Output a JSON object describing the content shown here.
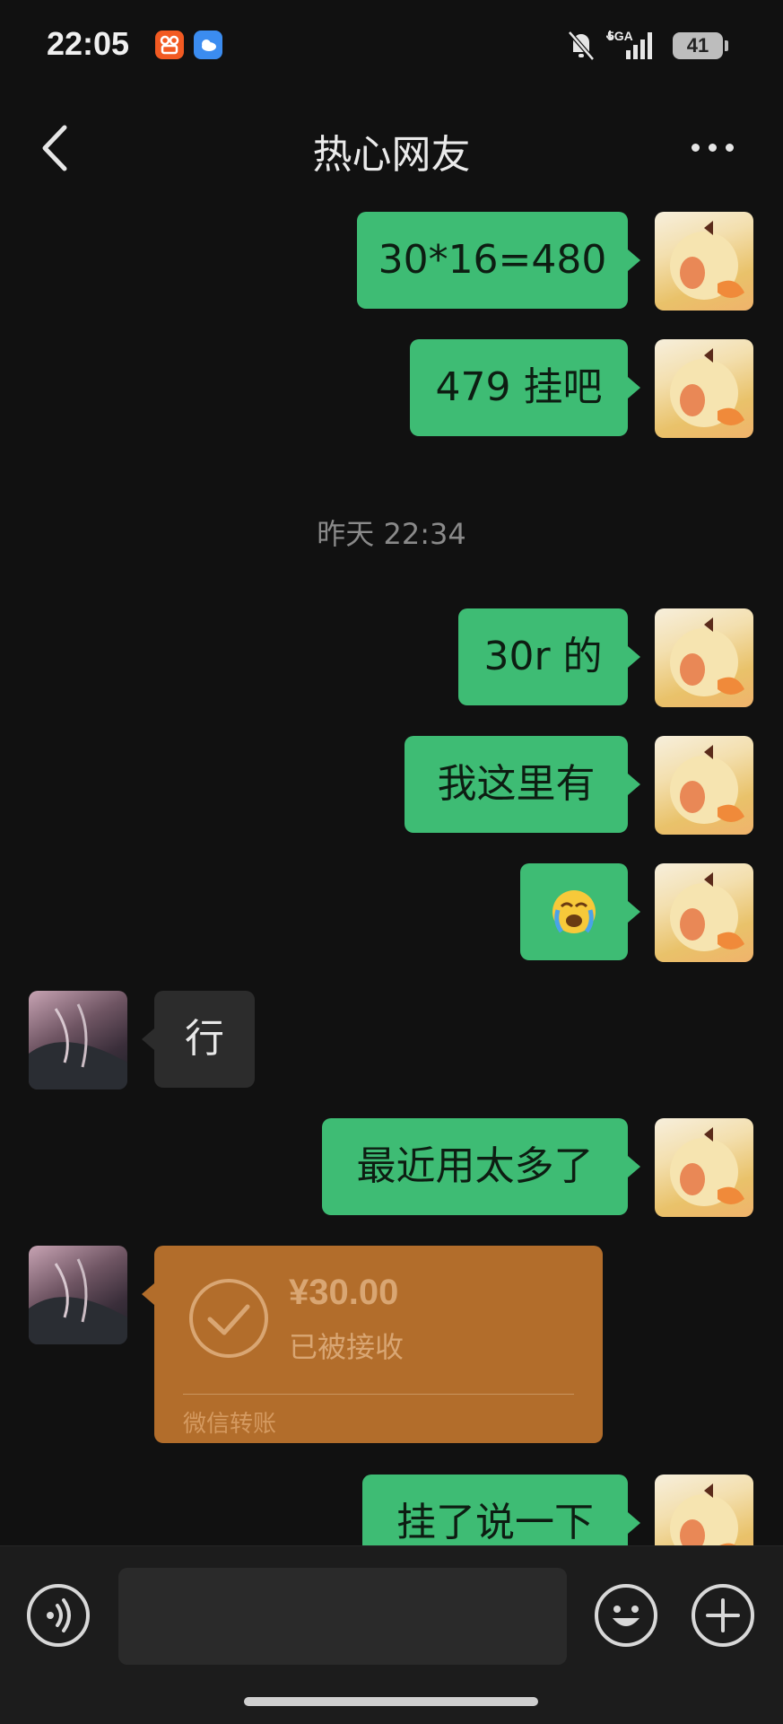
{
  "status_bar": {
    "time": "22:05",
    "network": "5GA",
    "battery": "41",
    "icons": [
      "app-icon-orange",
      "weather-icon",
      "mute-bell-icon",
      "signal-icon",
      "battery-icon"
    ]
  },
  "header": {
    "title": "热心网友",
    "back_icon": "chevron-left-icon",
    "more_icon": "more-dots-icon"
  },
  "messages": [
    {
      "from": "me",
      "text": "30*16=480"
    },
    {
      "from": "me",
      "text": "479 挂吧"
    },
    {
      "type": "timestamp",
      "text": "昨天 22:34"
    },
    {
      "from": "me",
      "text": "30r 的"
    },
    {
      "from": "me",
      "text": "我这里有"
    },
    {
      "from": "me",
      "emoji": "😭"
    },
    {
      "from": "them",
      "text": "行"
    },
    {
      "from": "me",
      "text": "最近用太多了"
    },
    {
      "from": "them",
      "type": "transfer",
      "amount": "¥30.00",
      "status": "已被接收",
      "label": "微信转账"
    },
    {
      "from": "me",
      "text": "挂了说一下"
    }
  ],
  "bottom_bar": {
    "voice_icon": "voice-icon",
    "emoji_icon": "emoji-icon",
    "plus_icon": "plus-icon"
  },
  "colors": {
    "background": "#111111",
    "my_bubble": "#3ebc74",
    "their_bubble": "#2c2c2c",
    "transfer_card": "#b26d2b"
  }
}
